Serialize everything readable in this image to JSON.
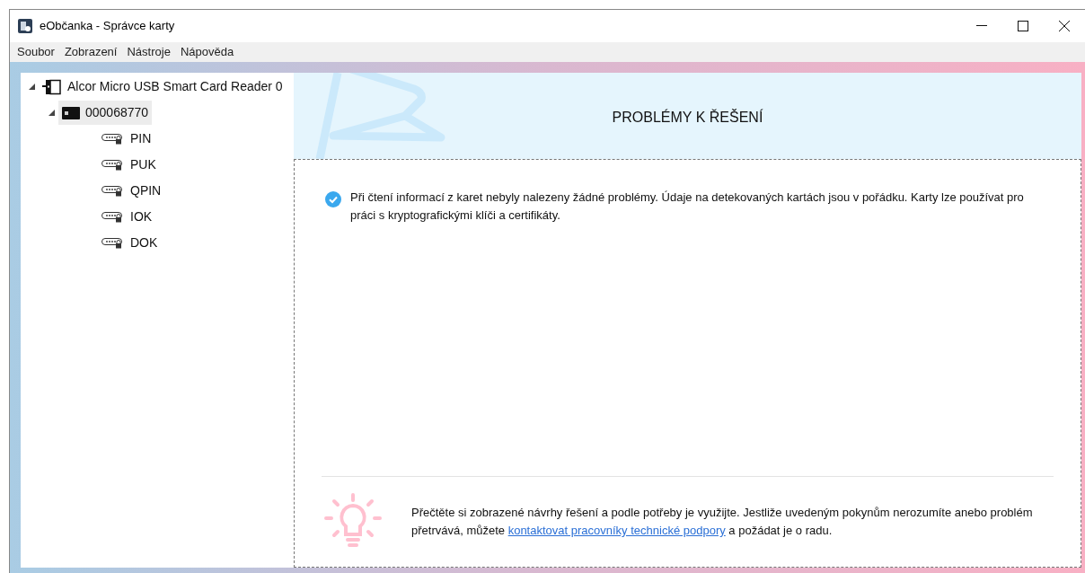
{
  "window": {
    "title": "eObčanka - Správce karty"
  },
  "menu": [
    "Soubor",
    "Zobrazení",
    "Nástroje",
    "Nápověda"
  ],
  "tree": [
    {
      "kind": "reader",
      "label": "Alcor Micro USB Smart Card Reader 0",
      "expanded": true,
      "selected": false,
      "children": [
        {
          "kind": "card",
          "label": "000068770",
          "expanded": true,
          "selected": true,
          "children": [
            {
              "kind": "pin",
              "label": "PIN",
              "selected": false
            },
            {
              "kind": "pin",
              "label": "PUK",
              "selected": false
            },
            {
              "kind": "pin",
              "label": "QPIN",
              "selected": false
            },
            {
              "kind": "pin",
              "label": "IOK",
              "selected": false
            },
            {
              "kind": "pin",
              "label": "DOK",
              "selected": false
            }
          ]
        }
      ]
    }
  ],
  "panel": {
    "title": "PROBLÉMY K ŘEŠENÍ",
    "messages": [
      {
        "kind": "ok",
        "text": "Při čtení informací z karet nebyly nalezeny žádné problémy. Údaje na detekovaných kartách jsou v pořádku. Karty lze používat pro práci s kryptografickými klíči a certifikáty."
      }
    ],
    "hint": {
      "before": "Přečtěte si zobrazené návrhy řešení a podle potřeby je využijte. Jestliže uvedeným pokynům nerozumíte anebo problém přetrvává, můžete ",
      "link": "kontaktovat pracovníky technické podpory",
      "after": " a požádat je o radu."
    }
  }
}
